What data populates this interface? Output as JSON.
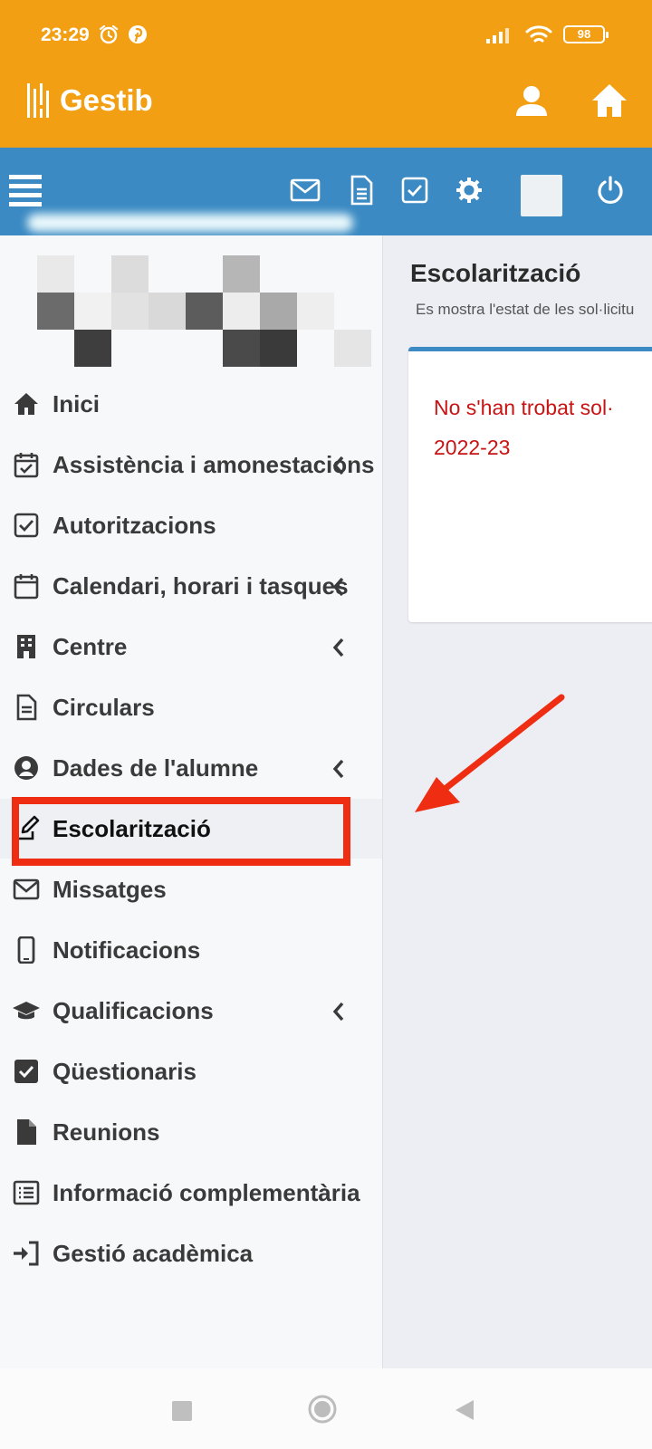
{
  "status_bar": {
    "time": "23:29",
    "battery": "98"
  },
  "header": {
    "brand": "Gestib",
    "color": "#f29f14"
  },
  "toolbar": {
    "color": "#3b8ac3",
    "buttons": [
      "envelope-icon",
      "document-icon",
      "checkbox-icon",
      "gear-icon",
      "power-icon"
    ]
  },
  "sidebar": {
    "items": [
      {
        "label": "Inici",
        "icon": "home-icon",
        "submenu": false
      },
      {
        "label": "Assistència i amonestacions",
        "icon": "calendar-check-icon",
        "submenu": true
      },
      {
        "label": "Autoritzacions",
        "icon": "checkbox-icon",
        "submenu": false
      },
      {
        "label": "Calendari, horari i tasques",
        "icon": "calendar-icon",
        "submenu": true
      },
      {
        "label": "Centre",
        "icon": "building-icon",
        "submenu": true
      },
      {
        "label": "Circulars",
        "icon": "document-icon",
        "submenu": false
      },
      {
        "label": "Dades de l'alumne",
        "icon": "user-circle-icon",
        "submenu": true
      },
      {
        "label": "Escolarització",
        "icon": "edit-icon",
        "submenu": false,
        "active": true
      },
      {
        "label": "Missatges",
        "icon": "envelope-icon",
        "submenu": false
      },
      {
        "label": "Notificacions",
        "icon": "mobile-icon",
        "submenu": false
      },
      {
        "label": "Qualificacions",
        "icon": "graduation-cap-icon",
        "submenu": true
      },
      {
        "label": "Qüestionaris",
        "icon": "checkbox-filled-icon",
        "submenu": false
      },
      {
        "label": "Reunions",
        "icon": "file-icon",
        "submenu": false
      },
      {
        "label": "Informació complementària",
        "icon": "list-icon",
        "submenu": false
      },
      {
        "label": "Gestió acadèmica",
        "icon": "sign-in-icon",
        "submenu": false
      }
    ]
  },
  "main": {
    "title": "Escolarització",
    "subtitle": "Es mostra l'estat de les sol·licitu",
    "message_line1": "No s'han trobat sol·",
    "message_line2": "2022-23",
    "message_color": "#c81313"
  },
  "annotation": {
    "color": "#ee2d12"
  }
}
